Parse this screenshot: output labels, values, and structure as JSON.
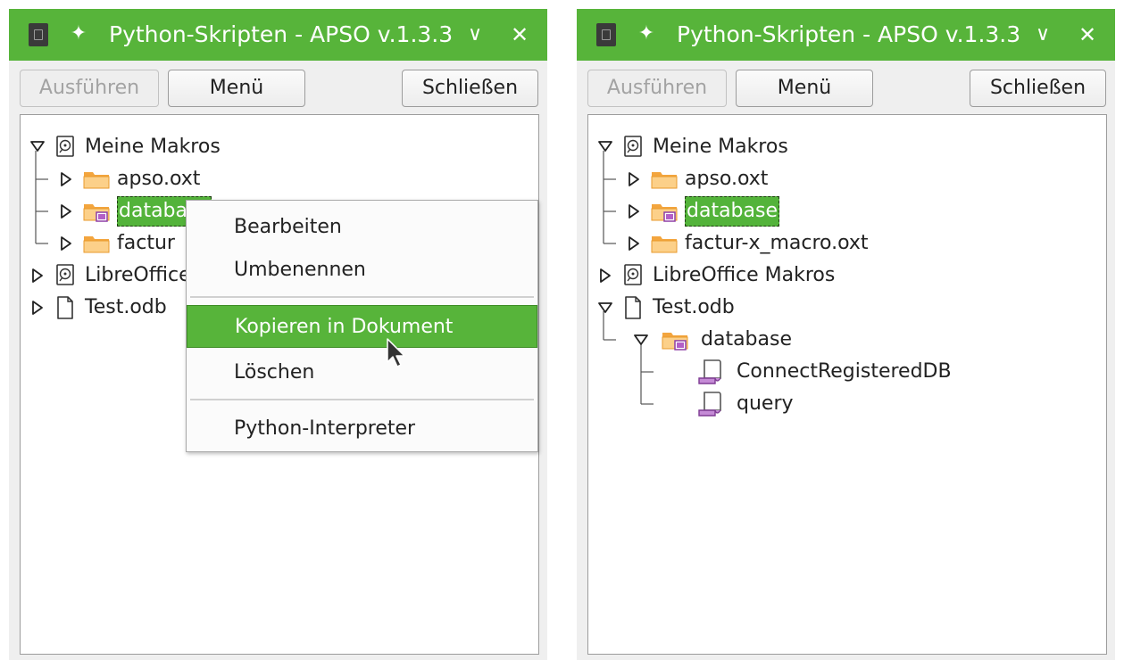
{
  "left_window": {
    "title": "Python-Skripten - APSO v.1.3.3",
    "buttons": {
      "run": "Ausführen",
      "menu": "Menü",
      "close": "Schließen"
    },
    "tree": [
      {
        "label": "Meine Makros",
        "icon": "disk-icon",
        "expanded": true
      },
      {
        "label": "apso.oxt",
        "icon": "folder-icon"
      },
      {
        "label": "database",
        "icon": "database-folder-icon",
        "selected": true
      },
      {
        "label": "factur",
        "icon": "folder-icon"
      },
      {
        "label": "LibreOffice",
        "icon": "disk-icon"
      },
      {
        "label": "Test.odb",
        "icon": "document-icon"
      }
    ],
    "context_menu": {
      "items": [
        "Bearbeiten",
        "Umbenennen",
        "Kopieren in Dokument",
        "Löschen",
        "Python-Interpreter"
      ],
      "highlighted": "Kopieren in Dokument"
    }
  },
  "right_window": {
    "title": "Python-Skripten - APSO v.1.3.3",
    "buttons": {
      "run": "Ausführen",
      "menu": "Menü",
      "close": "Schließen"
    },
    "tree": [
      {
        "label": "Meine Makros",
        "icon": "disk-icon",
        "expanded": true
      },
      {
        "label": "apso.oxt",
        "icon": "folder-icon"
      },
      {
        "label": "database",
        "icon": "database-folder-icon",
        "selected": true
      },
      {
        "label": "factur-x_macro.oxt",
        "icon": "folder-icon"
      },
      {
        "label": "LibreOffice Makros",
        "icon": "disk-icon"
      },
      {
        "label": "Test.odb",
        "icon": "document-icon",
        "expanded": true
      },
      {
        "label": "database",
        "icon": "database-folder-icon",
        "expanded": true
      },
      {
        "label": "ConnectRegisteredDB",
        "icon": "script-icon"
      },
      {
        "label": "query",
        "icon": "script-icon"
      }
    ]
  },
  "colors": {
    "accent": "#57b43a",
    "folder": "#f6b04a",
    "script": "#b35fc7"
  }
}
